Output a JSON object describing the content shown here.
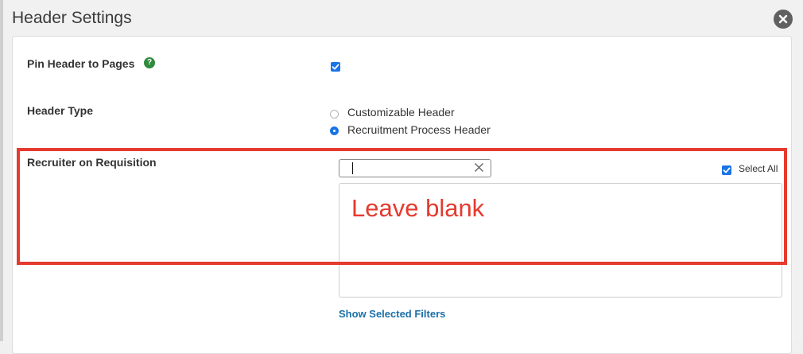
{
  "dialog": {
    "title": "Header Settings",
    "close_icon": "close-circle-icon"
  },
  "pin_header": {
    "label": "Pin Header to Pages",
    "help_icon": "question-circle-icon",
    "help_glyph": "?",
    "checked": true
  },
  "header_type": {
    "label": "Header Type",
    "options": [
      {
        "label": "Customizable Header",
        "selected": false
      },
      {
        "label": "Recruitment Process Header",
        "selected": true
      }
    ]
  },
  "recruiter": {
    "label": "Recruiter on Requisition",
    "search_value": "",
    "clear_icon": "clear-x-icon",
    "select_all_label": "Select All",
    "select_all_checked": true,
    "show_filters_label": "Show Selected Filters"
  },
  "annotation": {
    "text": "Leave blank",
    "color": "#e53a2f"
  },
  "colors": {
    "accent": "#1a73e8",
    "link": "#1b6fa8",
    "help": "#2e8b3d"
  }
}
